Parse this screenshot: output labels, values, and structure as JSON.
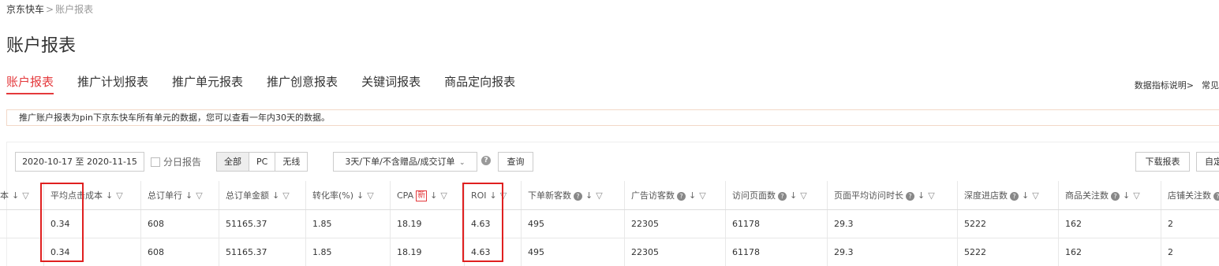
{
  "breadcrumb": {
    "root": "京东快车",
    "sep": ">",
    "current": "账户报表"
  },
  "page_title": "账户报表",
  "tabs": [
    "账户报表",
    "推广计划报表",
    "推广单元报表",
    "推广创意报表",
    "关键词报表",
    "商品定向报表"
  ],
  "top_right": {
    "metric_help": "数据指标说明>",
    "faq": "常见"
  },
  "notice": "推广账户报表为pin下京东快车所有单元的数据，您可以查看一年内30天的数据。",
  "toolbar": {
    "date_range": "2020-10-17 至 2020-11-15",
    "daily_report_label": "分日报告",
    "segments": [
      "全部",
      "PC",
      "无线"
    ],
    "active_segment": "全部",
    "order_type": "3天/下单/不含赠品/成交订单",
    "query_label": "查询",
    "download_label": "下载报表",
    "custom_label": "自定"
  },
  "table": {
    "columns": [
      {
        "label": "本",
        "help": false,
        "new": false
      },
      {
        "label": "平均点击成本",
        "help": false,
        "new": false
      },
      {
        "label": "总订单行",
        "help": false,
        "new": false
      },
      {
        "label": "总订单金额",
        "help": false,
        "new": false
      },
      {
        "label": "转化率(%)",
        "help": false,
        "new": false
      },
      {
        "label": "CPA",
        "help": false,
        "new": true,
        "new_label": "新"
      },
      {
        "label": "ROI",
        "help": false,
        "new": false
      },
      {
        "label": "下单新客数",
        "help": true,
        "new": false
      },
      {
        "label": "广告访客数",
        "help": true,
        "new": false
      },
      {
        "label": "访问页面数",
        "help": true,
        "new": false
      },
      {
        "label": "页面平均访问时长",
        "help": true,
        "new": false
      },
      {
        "label": "深度进店数",
        "help": true,
        "new": false
      },
      {
        "label": "商品关注数",
        "help": true,
        "new": false
      },
      {
        "label": "店铺关注数",
        "help": true,
        "new": false
      }
    ],
    "rows": [
      [
        "",
        "0.34",
        "608",
        "51165.37",
        "1.85",
        "18.19",
        "4.63",
        "495",
        "22305",
        "61178",
        "29.3",
        "5222",
        "162",
        "2"
      ],
      [
        "",
        "0.34",
        "608",
        "51165.37",
        "1.85",
        "18.19",
        "4.63",
        "495",
        "22305",
        "61178",
        "29.3",
        "5222",
        "162",
        "2"
      ]
    ]
  },
  "colors": {
    "accent": "#e4393c",
    "highlight_box": "#e02020"
  }
}
